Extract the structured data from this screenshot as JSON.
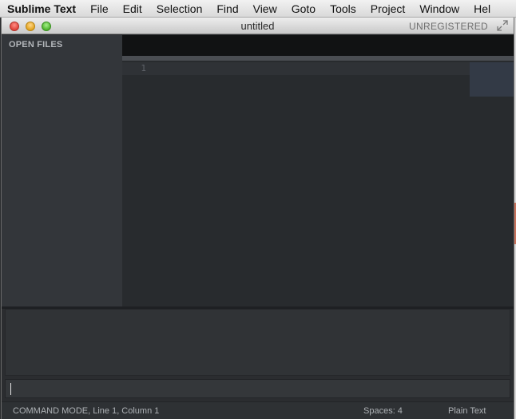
{
  "menubar": {
    "app_name": "Sublime Text",
    "items": [
      "File",
      "Edit",
      "Selection",
      "Find",
      "View",
      "Goto",
      "Tools",
      "Project",
      "Window",
      "Hel"
    ]
  },
  "window": {
    "title": "untitled",
    "registration": "UNREGISTERED",
    "fullscreen_icon": "expand-arrows-icon"
  },
  "sidebar": {
    "heading": "OPEN FILES"
  },
  "editor": {
    "line_numbers": [
      "1"
    ]
  },
  "statusbar": {
    "mode": "COMMAND MODE, Line 1, Column 1",
    "spaces": "Spaces: 4",
    "syntax": "Plain Text"
  },
  "colors": {
    "editor_bg": "#282b2e",
    "sidebar_bg": "#33363a",
    "tabbar_bg": "#111213"
  }
}
